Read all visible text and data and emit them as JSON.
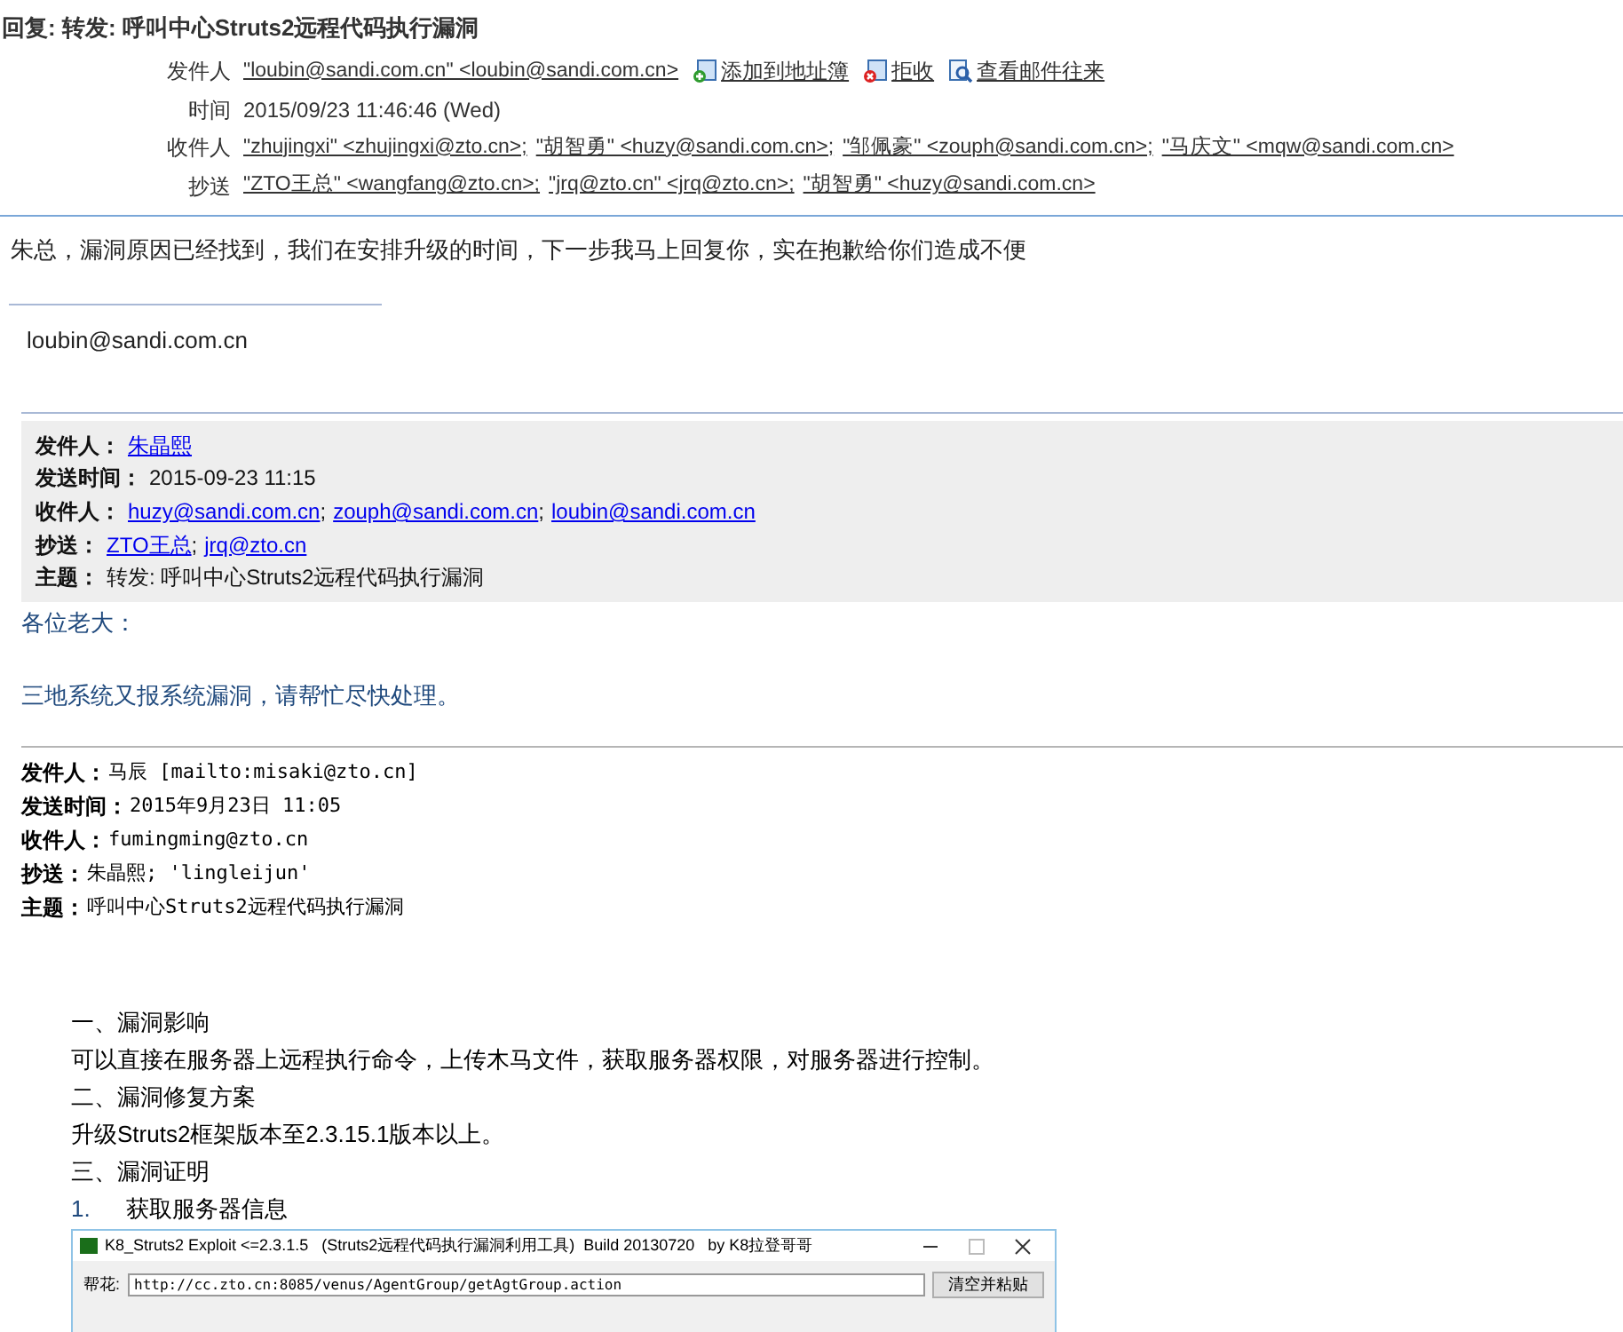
{
  "subject": "回复: 转发: 呼叫中心Struts2远程代码执行漏洞",
  "header": [
    {
      "label": "发件人",
      "kind": "list",
      "parts": [
        "\"loubin@sandi.com.cn\" <loubin@sandi.com.cn>"
      ],
      "actions": [
        "添加到地址簿",
        "拒收",
        "查看邮件往来"
      ]
    },
    {
      "label": "时间",
      "kind": "text",
      "text": "2015/09/23 11:46:46 (Wed)"
    },
    {
      "label": "收件人",
      "kind": "list",
      "parts": [
        "\"zhujingxi\" <zhujingxi@zto.cn>;",
        "\"胡智勇\" <huzy@sandi.com.cn>;",
        "\"邹佩豪\" <zouph@sandi.com.cn>;",
        "\"马庆文\" <mqw@sandi.com.cn>"
      ]
    },
    {
      "label": "抄送",
      "kind": "list",
      "parts": [
        "\"ZTO王总\" <wangfang@zto.cn>;",
        "\"jrq@zto.cn\" <jrq@zto.cn>;",
        "\"胡智勇\" <huzy@sandi.com.cn>"
      ]
    }
  ],
  "body": "朱总，漏洞原因已经找到，我们在安排升级的时间，下一步我马上回复你，实在抱歉给你们造成不便",
  "signature": "loubin@sandi.com.cn",
  "quoted_header": [
    {
      "label": "发件人：",
      "links": [
        "朱晶熙"
      ]
    },
    {
      "label": "发送时间：",
      "text": "2015-09-23 11:15"
    },
    {
      "label": "收件人：",
      "links": [
        "huzy@sandi.com.cn",
        "zouph@sandi.com.cn",
        "loubin@sandi.com.cn"
      ],
      "separator": ";"
    },
    {
      "label": "抄送：",
      "links": [
        "ZTO王总",
        "jrq@zto.cn"
      ],
      "separator": ";"
    },
    {
      "label": "主题：",
      "text": "转发: 呼叫中心Struts2远程代码执行漏洞"
    }
  ],
  "quoted_body": [
    "各位老大：",
    "三地系统又报系统漏洞，请帮忙尽快处理。"
  ],
  "forwarded_header": [
    {
      "label": "发件人：",
      "text": "马辰 [mailto:misaki@zto.cn]"
    },
    {
      "label": "发送时间：",
      "text": "2015年9月23日 11:05"
    },
    {
      "label": "收件人：",
      "text": "fumingming@zto.cn"
    },
    {
      "label": "抄送：",
      "text": "朱晶熙; 'lingleijun'"
    },
    {
      "label": "主题：",
      "text": "呼叫中心Struts2远程代码执行漏洞"
    }
  ],
  "report": [
    {
      "kind": "heading",
      "text": "一、漏洞影响"
    },
    {
      "kind": "para",
      "text": "可以直接在服务器上远程执行命令，上传木马文件，获取服务器权限，对服务器进行控制。"
    },
    {
      "kind": "heading",
      "text": "二、漏洞修复方案"
    },
    {
      "kind": "para",
      "text": "升级Struts2框架版本至2.3.15.1版本以上。"
    },
    {
      "kind": "heading",
      "text": "三、漏洞证明"
    },
    {
      "kind": "numbered",
      "number": "1.",
      "text": "获取服务器信息"
    }
  ],
  "embedded_window": {
    "title": "K8_Struts2 Exploit <=2.3.1.5   (Struts2远程代码执行漏洞利用工具)  Build 20130720   by K8拉登哥哥",
    "field_label": "帮花:",
    "url": "http://cc.zto.cn:8085/venus/AgentGroup/getAgtGroup.action",
    "button": "清空并粘贴"
  }
}
